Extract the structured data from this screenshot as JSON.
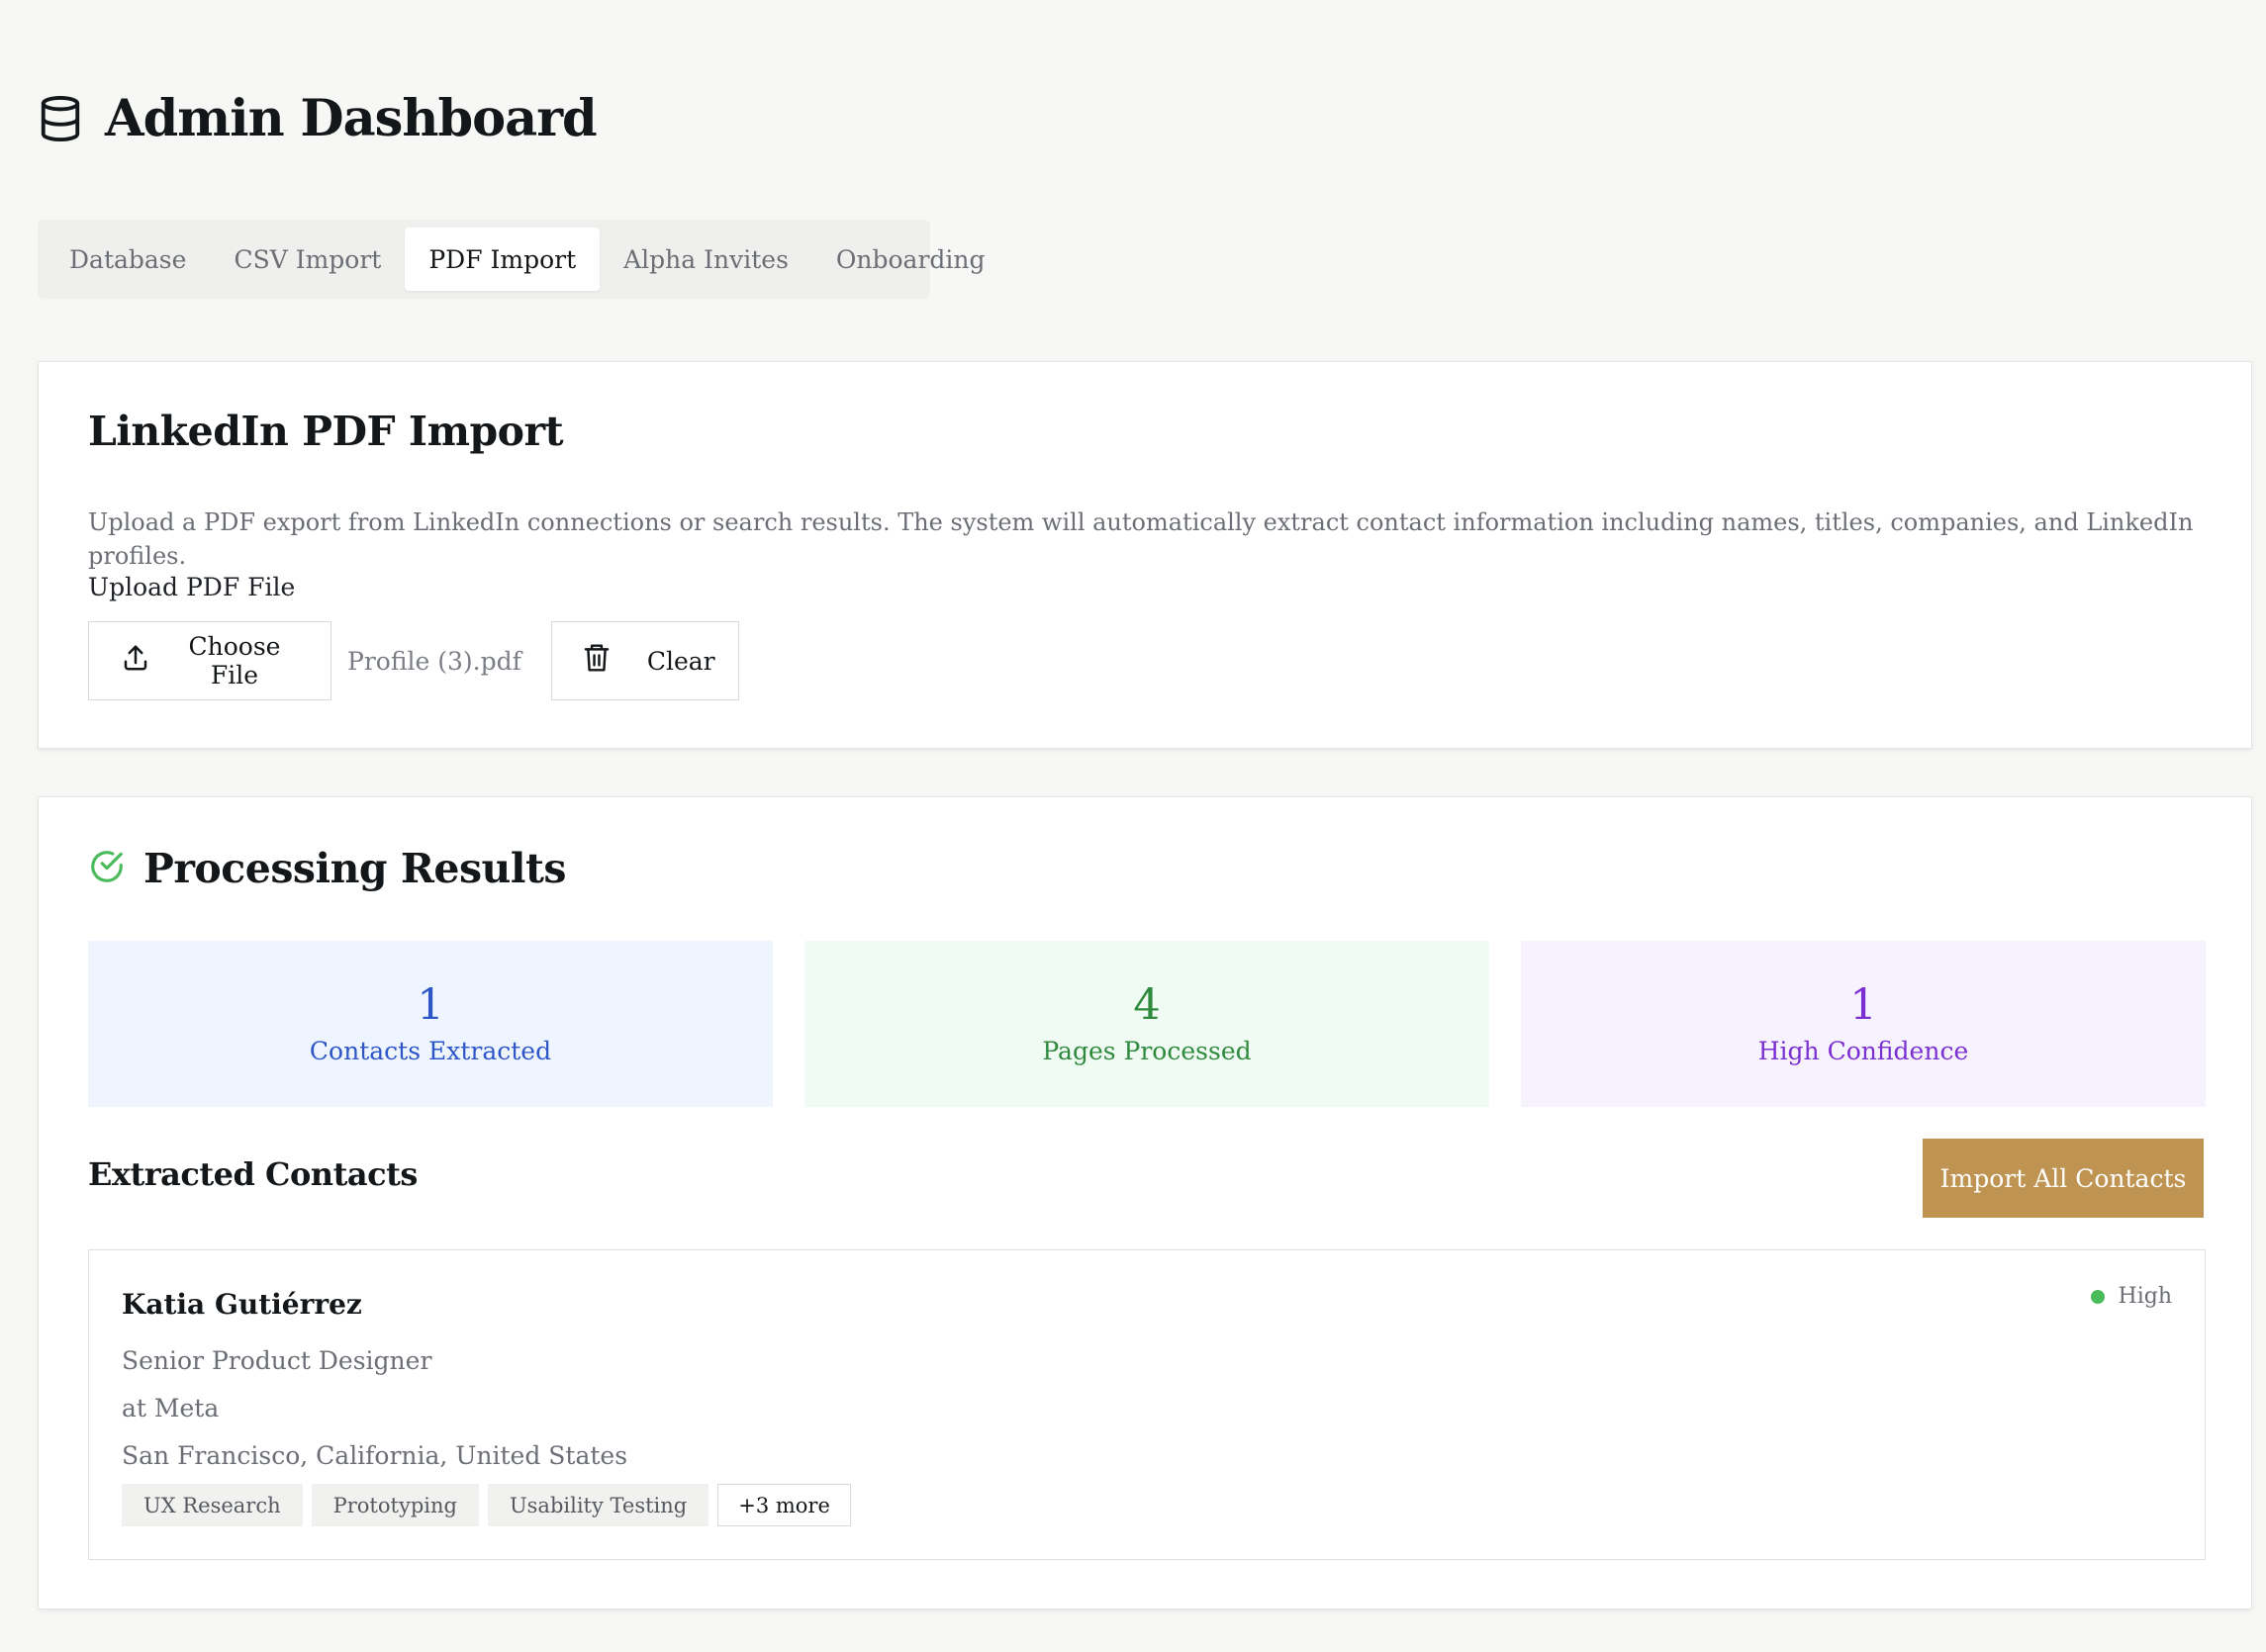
{
  "header": {
    "title": "Admin Dashboard",
    "icon": "database-icon"
  },
  "tabs": [
    {
      "label": "Database",
      "active": false
    },
    {
      "label": "CSV Import",
      "active": false
    },
    {
      "label": "PDF Import",
      "active": true
    },
    {
      "label": "Alpha Invites",
      "active": false
    },
    {
      "label": "Onboarding",
      "active": false
    }
  ],
  "import_card": {
    "title": "LinkedIn PDF Import",
    "description": "Upload a PDF export from LinkedIn connections or search results. The system will automatically extract contact information including names, titles, companies, and LinkedIn profiles.",
    "upload_label": "Upload PDF File",
    "choose_button": "Choose File",
    "choose_icon": "upload-icon",
    "file_name": "Profile (3).pdf",
    "clear_button": "Clear",
    "clear_icon": "trash-icon"
  },
  "results": {
    "title": "Processing Results",
    "title_icon": "check-circle-icon",
    "stats": [
      {
        "value": "1",
        "label": "Contacts Extracted",
        "color": "#2e56c8",
        "bg": "#eff5fe"
      },
      {
        "value": "4",
        "label": "Pages Processed",
        "color": "#2f8a3e",
        "bg": "#f0fbf3"
      },
      {
        "value": "1",
        "label": "High Confidence",
        "color": "#7b2fd0",
        "bg": "#f7f3fe"
      }
    ],
    "extracted_title": "Extracted Contacts",
    "import_all_button": "Import All Contacts",
    "accent_color": "#bf9452",
    "contacts": [
      {
        "name": "Katia Gutiérrez",
        "title": "Senior Product Designer",
        "company": "at Meta",
        "location": "San Francisco, California, United States",
        "confidence": "High",
        "confidence_color": "#4cbb5c",
        "skills": [
          "UX Research",
          "Prototyping",
          "Usability Testing"
        ],
        "more": "+3 more"
      }
    ]
  }
}
